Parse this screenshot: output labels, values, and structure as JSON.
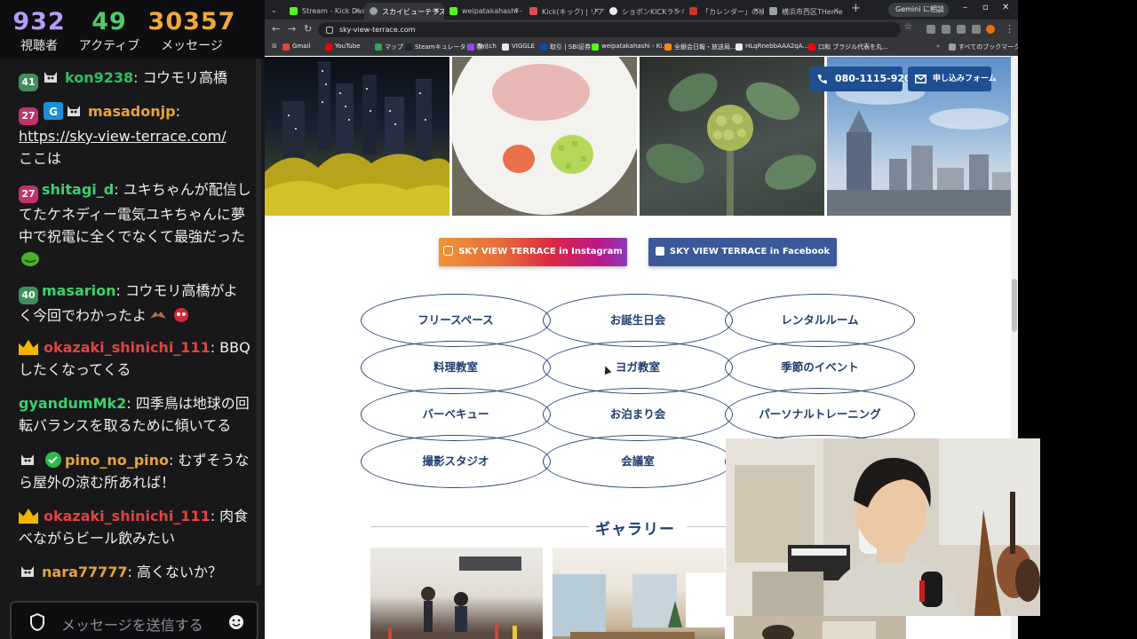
{
  "chat": {
    "stats": {
      "viewers": "932",
      "viewers_label": "視聴者",
      "active": "49",
      "active_label": "アクティブ",
      "messages": "30357",
      "messages_label": "メッセージ"
    },
    "messages": [
      {
        "badges": [
          "41",
          "cat"
        ],
        "user": "kon9238",
        "user_color": "#2ec05c",
        "text": ": コウモリ高橋"
      },
      {
        "badges": [
          "27",
          "mc",
          "cat"
        ],
        "user": "masadonjp",
        "user_color": "#e8a33d",
        "text": ":",
        "link": "https://sky-view-terrace.com/",
        "tail": "ここは"
      },
      {
        "badges": [
          "27"
        ],
        "user": "shitagi_d",
        "user_color": "#39d26a",
        "text": ": ユキちゃんが配信してたケネディー電気ユキちゃんに夢中で祝電に全くでなくて最強だった"
      },
      {
        "badges": [
          "40"
        ],
        "user": "masarion",
        "user_color": "#39d26a",
        "text": ": コウモリ高橋がよく今回でわかったよ"
      },
      {
        "badges": [
          "crown"
        ],
        "user": "okazaki_shinichi_111",
        "user_color": "#e0443e",
        "text": ": BBQしたくなってくる"
      },
      {
        "badges": [],
        "user": "gyandumMk2",
        "user_color": "#39d26a",
        "text": ": 四季鳥は地球の回転バランスを取るために傾いてる"
      },
      {
        "badges": [
          "cat",
          "verified"
        ],
        "user": "pino_no_pino",
        "user_color": "#e8a33d",
        "text": ": むずそうなら屋外の涼む所あれば！"
      },
      {
        "badges": [
          "crown"
        ],
        "user": "okazaki_shinichi_111",
        "user_color": "#e0443e",
        "text": ": 肉食べながらビール飲みたい"
      },
      {
        "badges": [
          "cat"
        ],
        "user": "nara77777",
        "user_color": "#e8a33d",
        "text": ": 高くないか？"
      }
    ],
    "input_placeholder": "メッセージを送信する"
  },
  "browser": {
    "tabs": [
      {
        "label": "Stream - Kick Dash",
        "color": "#53fc18"
      },
      {
        "label": "スカイビューテラス ヨコ",
        "color": "#9aa0a6"
      },
      {
        "label": "weipatakahashi - V",
        "color": "#53fc18"
      },
      {
        "label": "Kick(キック) | リアル",
        "color": "#e24b4b"
      },
      {
        "label": "ショボンKICKランキン",
        "color": "#e8eaed"
      },
      {
        "label": "「カレンダー」の検索",
        "color": "#d93025"
      },
      {
        "label": "横浜市西区THeme",
        "color": "#9aa0a6"
      }
    ],
    "gemini_label": "Gemini に相談",
    "url": "sky-view-terrace.com",
    "bookmarks": [
      {
        "label": "Gmail",
        "color": "#ea4335"
      },
      {
        "label": "YouTube",
        "color": "#ff0000"
      },
      {
        "label": "マップ",
        "color": "#34a853"
      },
      {
        "label": "Steamキュレーター: 収...",
        "color": "#1b2838"
      },
      {
        "label": "Twitch",
        "color": "#9146ff"
      },
      {
        "label": "VIGGLE",
        "color": "#e8eaed"
      },
      {
        "label": "取引 | SBI証券",
        "color": "#0b4ea2"
      },
      {
        "label": "weipatakahashi - Ki...",
        "color": "#53fc18"
      },
      {
        "label": "全銀会日報・放送局...",
        "color": "#f28b00"
      },
      {
        "label": "HLqRnebbAAA2qA...",
        "color": "#e8eaed"
      },
      {
        "label": "口和 ブラジル代表を丸...",
        "color": "#ff0000"
      }
    ],
    "all_bookmarks_label": "すべてのブックマーク"
  },
  "site": {
    "phone": "080-1115-9201",
    "form_label": "申し込みフォーム",
    "instagram_label": "SKY VIEW TERRACE in Instagram",
    "facebook_label": "SKY VIEW TERRACE in Facebook",
    "uses": [
      "フリースペース",
      "お誕生日会",
      "レンタルルーム",
      "料理教室",
      "ヨガ教室",
      "季節のイベント",
      "バーベキュー",
      "お泊まり会",
      "パーソナルトレーニング",
      "撮影スタジオ",
      "会議室"
    ],
    "gallery_title": "ギャラリー"
  }
}
